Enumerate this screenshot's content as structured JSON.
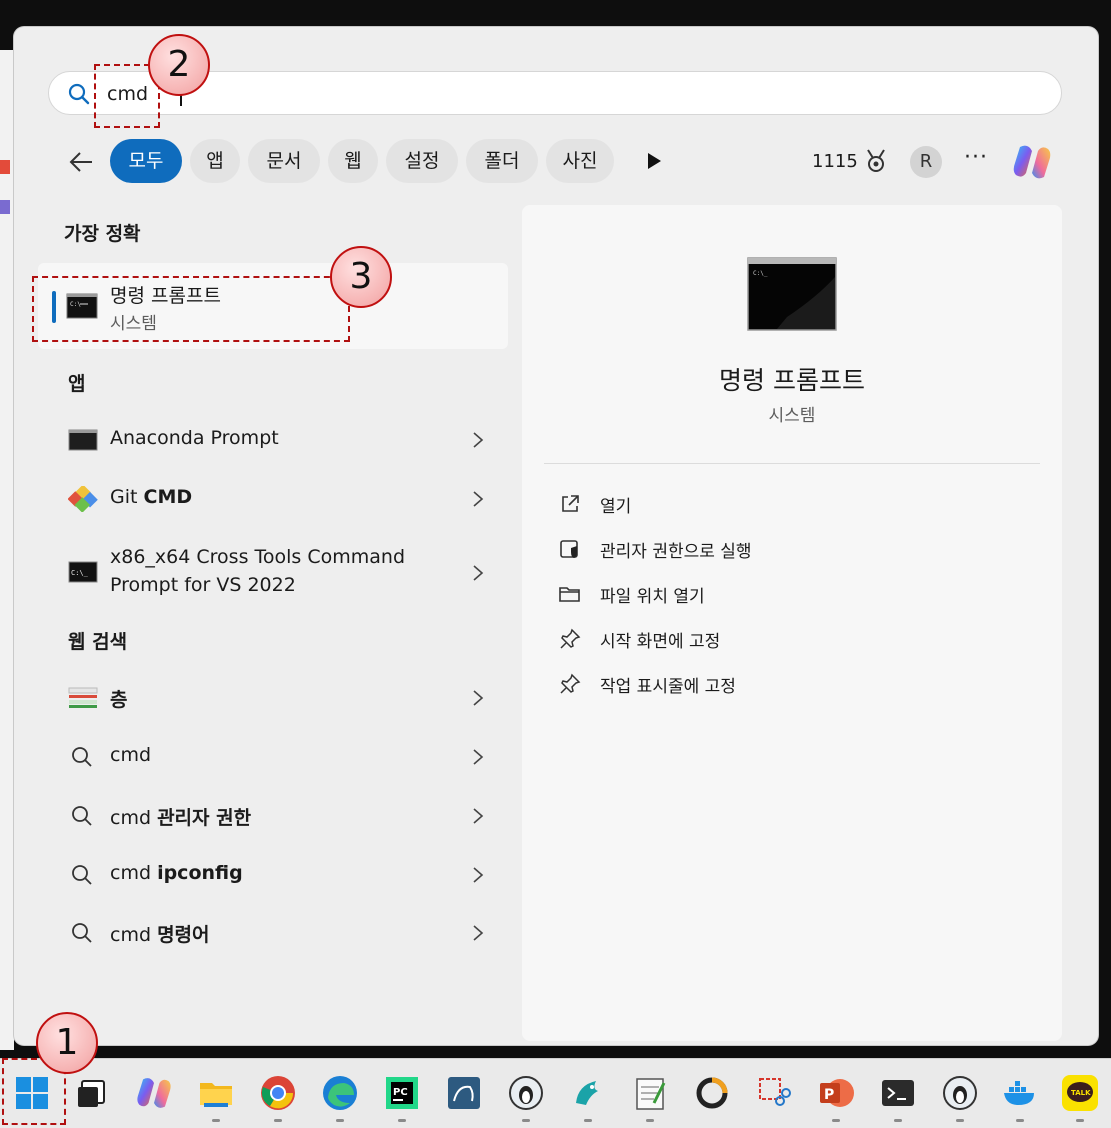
{
  "search": {
    "value": "cmd",
    "placeholder": ""
  },
  "filters": {
    "items": [
      "모두",
      "앱",
      "문서",
      "웹",
      "설정",
      "폴더",
      "사진"
    ],
    "points": "1115",
    "avatar": "R",
    "more": "···"
  },
  "best_match": {
    "heading": "가장 정확",
    "title": "명령 프롬프트",
    "subtitle": "시스템"
  },
  "apps": {
    "heading": "앱",
    "items": [
      {
        "label": "Anaconda Prompt"
      },
      {
        "label_plain": "Git ",
        "label_bold": "CMD"
      },
      {
        "line1": "x86_x64 Cross Tools Command",
        "line2": "Prompt for VS 2022"
      }
    ]
  },
  "web": {
    "heading": "웹 검색",
    "items": [
      {
        "plain": "",
        "bold": "층"
      },
      {
        "plain": "cmd",
        "bold": ""
      },
      {
        "plain": "cmd ",
        "bold": "관리자 권한"
      },
      {
        "plain": "cmd ",
        "bold": "ipconfig"
      },
      {
        "plain": "cmd ",
        "bold": "명령어"
      }
    ]
  },
  "detail": {
    "title": "명령 프롬프트",
    "subtitle": "시스템",
    "actions": [
      "열기",
      "관리자 권한으로 실행",
      "파일 위치 열기",
      "시작 화면에 고정",
      "작업 표시줄에 고정"
    ]
  },
  "annotations": [
    "1",
    "2",
    "3"
  ],
  "colors": {
    "accent": "#0f6cbd",
    "annotation_red": "#c01010"
  }
}
